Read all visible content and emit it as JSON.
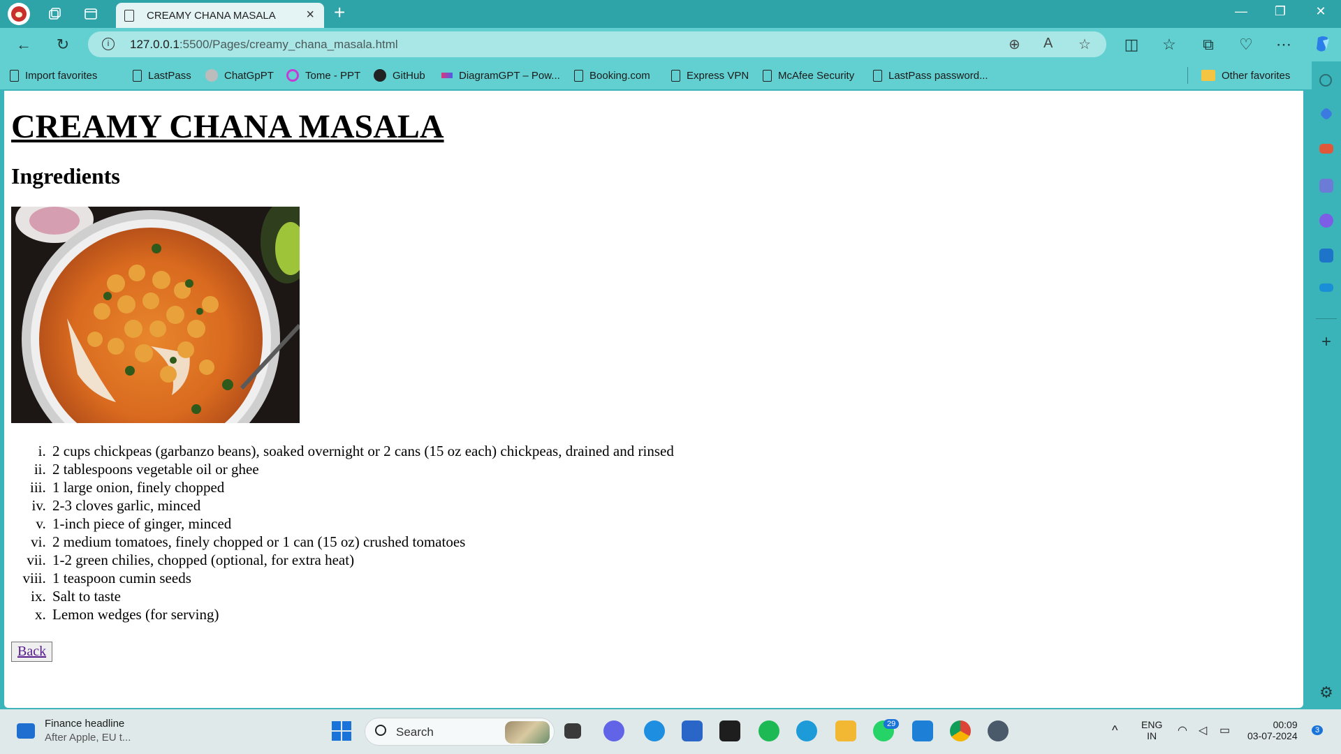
{
  "browser": {
    "tab_title": "CREAMY CHANA MASALA",
    "url_host": "127.0.0.1",
    "url_path": ":5500/Pages/creamy_chana_masala.html",
    "favorites": [
      "Import favorites",
      "LastPass",
      "ChatGpPT",
      "Tome - PPT",
      "GitHub",
      "DiagramGPT – Pow...",
      "Booking.com",
      "Express VPN",
      "McAfee Security",
      "LastPass password..."
    ],
    "other_favorites": "Other favorites",
    "accent": "#2ea3a8"
  },
  "page": {
    "title": "CREAMY CHANA MASALA",
    "section_heading": "Ingredients",
    "ingredients": [
      "2 cups chickpeas (garbanzo beans), soaked overnight or 2 cans (15 oz each) chickpeas, drained and rinsed",
      "2 tablespoons vegetable oil or ghee",
      "1 large onion, finely chopped",
      "2-3 cloves garlic, minced",
      "1-inch piece of ginger, minced",
      "2 medium tomatoes, finely chopped or 1 can (15 oz) crushed tomatoes",
      "1-2 green chilies, chopped (optional, for extra heat)",
      "1 teaspoon cumin seeds",
      "Salt to taste",
      "Lemon wedges (for serving)"
    ],
    "back_label": "Back"
  },
  "taskbar": {
    "news_title": "Finance headline",
    "news_sub": "After Apple, EU t...",
    "search_placeholder": "Search",
    "whatsapp_badge": "29",
    "lang_top": "ENG",
    "lang_bottom": "IN",
    "time": "00:09",
    "date": "03-07-2024",
    "notif_count": "3"
  }
}
